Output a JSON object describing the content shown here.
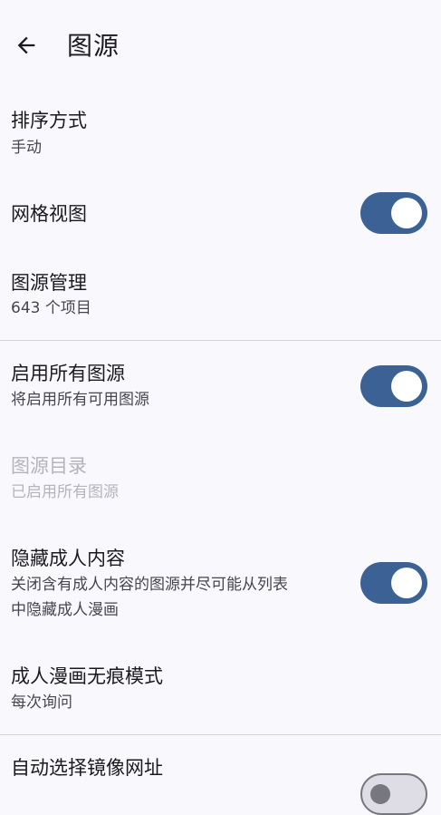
{
  "header": {
    "title": "图源"
  },
  "settings": [
    {
      "title": "排序方式",
      "subtitle": "手动"
    },
    {
      "title": "网格视图",
      "toggle": true
    },
    {
      "title": "图源管理",
      "subtitle": "643 个项目"
    },
    {
      "title": "启用所有图源",
      "subtitle": "将启用所有可用图源",
      "toggle": true
    },
    {
      "title": "图源目录",
      "subtitle": "已启用所有图源",
      "disabled": true
    },
    {
      "title": "隐藏成人内容",
      "subtitle_line1": "关闭含有成人内容的图源并尽可能从列表",
      "subtitle_line2": "中隐藏成人漫画",
      "toggle": true
    },
    {
      "title": "成人漫画无痕模式",
      "subtitle": "每次询问"
    },
    {
      "title": "自动选择镜像网址",
      "toggle": false
    }
  ],
  "colors": {
    "accent": "#3c6194",
    "background": "#f9f8fd",
    "divider": "#d4d3da",
    "disabled_text": "#b4b4bb"
  },
  "icons": {
    "back": "arrow-left-icon"
  }
}
